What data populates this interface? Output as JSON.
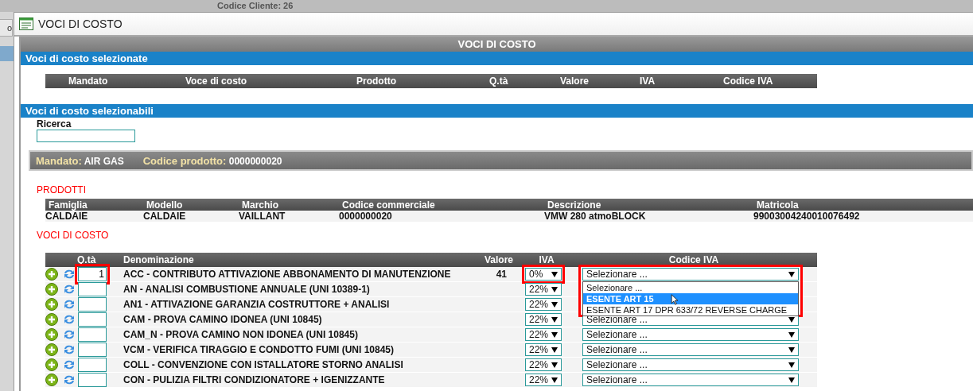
{
  "background": {
    "left_tab": "o",
    "customer_code": "Codice Cliente: 26"
  },
  "dialog": {
    "title": "VOCI DI COSTO",
    "header": "VOCI DI COSTO",
    "selected_section": {
      "title": "Voci di costo selezionate",
      "columns": [
        "Mandato",
        "Voce di costo",
        "Prodotto",
        "Q.tà",
        "Valore",
        "IVA",
        "Codice IVA"
      ]
    },
    "selectable_section": {
      "title": "Voci di costo selezionabili",
      "search": {
        "label": "Ricerca"
      }
    },
    "mandate_bar": {
      "mandate_label": "Mandato:",
      "mandate_value": "AIR GAS",
      "product_label": "Codice prodotto:",
      "product_value": "0000000020"
    },
    "products": {
      "title": "PRODOTTI",
      "columns": [
        "Famiglia",
        "Modello",
        "Marchio",
        "Codice commerciale",
        "Descrizione",
        "Matricola"
      ],
      "rows": [
        [
          "CALDAIE",
          "CALDAIE",
          "VAILLANT",
          "0000000020",
          "VMW 280 atmoBLOCK",
          "99003004240010076492"
        ]
      ]
    },
    "costs": {
      "title": "VOCI DI COSTO",
      "columns": [
        "Q.tà",
        "Denominazione",
        "Valore",
        "IVA",
        "Codice IVA"
      ],
      "rows": [
        {
          "qty": "1",
          "name": "ACC - CONTRIBUTO ATTIVAZIONE ABBONAMENTO DI MANUTENZIONE",
          "value": "41",
          "iva": "0%",
          "codice_iva": "Selezionare ...",
          "highlighted": true,
          "dropdown": {
            "options": [
              {
                "label": "Selezionare ...",
                "selected": false
              },
              {
                "label": "ESENTE ART 15",
                "selected": true
              },
              {
                "label": "ESENTE ART 17 DPR 633/72 REVERSE CHARGE",
                "selected": false
              }
            ]
          }
        },
        {
          "name": "AN - ANALISI COMBUSTIONE ANNUALE (UNI 10389-1)",
          "iva": "22%",
          "highlighted": false
        },
        {
          "name": "AN1 - ATTIVAZIONE GARANZIA COSTRUTTORE + ANALISI",
          "iva": "22%",
          "highlighted": false
        },
        {
          "name": "CAM - PROVA CAMINO IDONEA (UNI 10845)",
          "iva": "22%",
          "codice_iva": "Selezionare ...",
          "highlighted": false
        },
        {
          "name": "CAM_N - PROVA CAMINO NON IDONEA (UNI 10845)",
          "iva": "22%",
          "codice_iva": "Selezionare ...",
          "highlighted": false
        },
        {
          "name": "VCM - VERIFICA TIRAGGIO E CONDOTTO FUMI (UNI 10845)",
          "iva": "22%",
          "codice_iva": "Selezionare ...",
          "highlighted": false
        },
        {
          "name": "COLL - CONVENZIONE CON ISTALLATORE STORNO ANALISI",
          "iva": "22%",
          "codice_iva": "Selezionare ...",
          "highlighted": false
        },
        {
          "name": "CON - PULIZIA FILTRI CONDIZIONATORE + IGENIZZANTE",
          "iva": "22%",
          "codice_iva": "Selezionare ...",
          "highlighted": false
        }
      ]
    }
  }
}
